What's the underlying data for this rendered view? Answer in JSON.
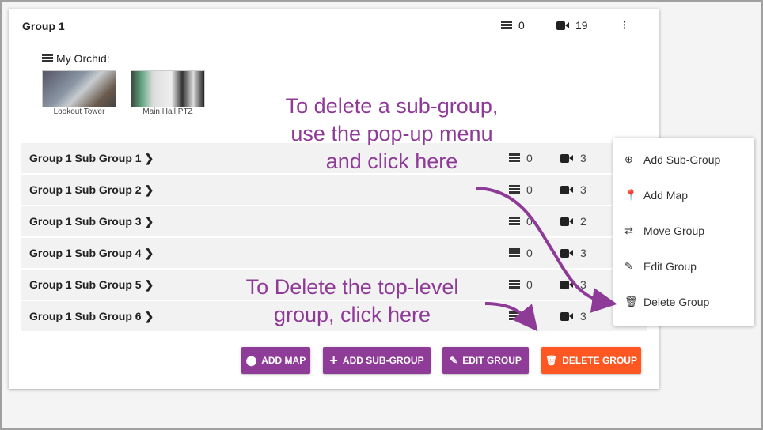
{
  "group": {
    "title": "Group 1",
    "server_count": "0",
    "camera_count": "19"
  },
  "orchid": {
    "label": "My Orchid:",
    "cameras": [
      {
        "name": "Lookout Tower"
      },
      {
        "name": "Main Hall PTZ"
      }
    ]
  },
  "subgroups": [
    {
      "name": "Group 1 Sub Group 1",
      "servers": "0",
      "cameras": "3"
    },
    {
      "name": "Group 1 Sub Group 2",
      "servers": "0",
      "cameras": "3"
    },
    {
      "name": "Group 1 Sub Group 3",
      "servers": "0",
      "cameras": "2"
    },
    {
      "name": "Group 1 Sub Group 4",
      "servers": "0",
      "cameras": "3"
    },
    {
      "name": "Group 1 Sub Group 5",
      "servers": "0",
      "cameras": "3"
    },
    {
      "name": "Group 1 Sub Group 6",
      "servers": "0",
      "cameras": "3"
    }
  ],
  "buttons": {
    "add_map": "ADD MAP",
    "add_sub_group": "ADD SUB-GROUP",
    "edit_group": "EDIT GROUP",
    "delete_group": "DELETE GROUP"
  },
  "menu": {
    "items": [
      {
        "label": "Add Sub-Group",
        "icon": "plus-circle-icon"
      },
      {
        "label": "Add Map",
        "icon": "map-pin-icon"
      },
      {
        "label": "Move Group",
        "icon": "swap-icon"
      },
      {
        "label": "Edit Group",
        "icon": "pencil-icon"
      },
      {
        "label": "Delete Group",
        "icon": "trash-icon"
      }
    ]
  },
  "annotations": {
    "sub_group": "To delete a sub-group, use the pop-up menu and click here",
    "top_level": "To Delete the top-level group, click here"
  },
  "colors": {
    "accent": "#8f3b98",
    "danger": "#fe5722",
    "annotation": "#8e3a97"
  }
}
